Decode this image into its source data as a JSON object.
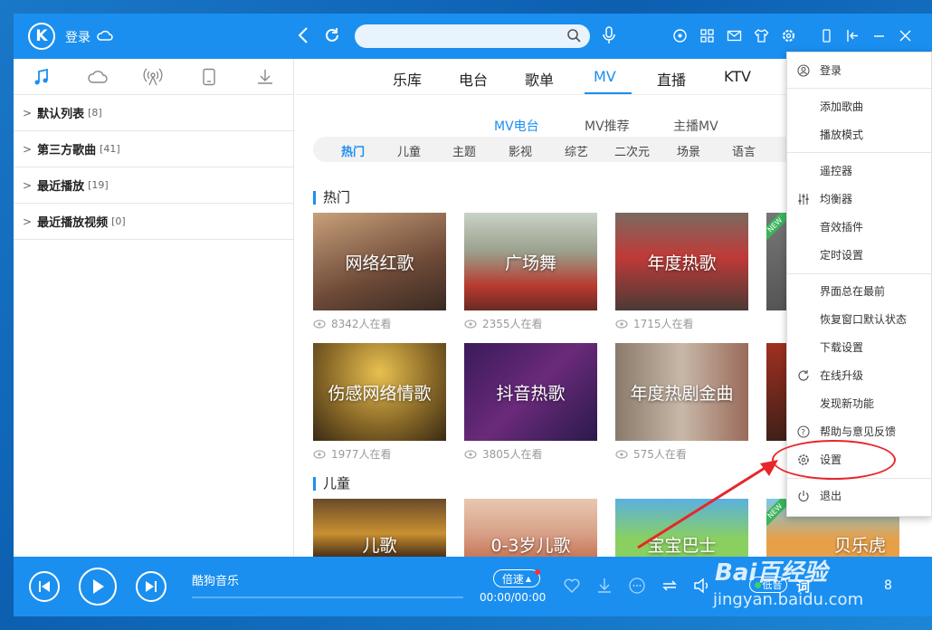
{
  "titlebar": {
    "login": "登录"
  },
  "sidebar": {
    "tabs": [
      "music-note-icon",
      "cloud-icon",
      "radio-icon",
      "device-icon",
      "download-icon"
    ],
    "playlists": [
      {
        "label": "默认列表",
        "count": "[8]"
      },
      {
        "label": "第三方歌曲",
        "count": "[41]"
      },
      {
        "label": "最近播放",
        "count": "[19]"
      },
      {
        "label": "最近播放视频",
        "count": "[0]"
      }
    ]
  },
  "main": {
    "tabs": [
      "乐库",
      "电台",
      "歌单",
      "MV",
      "直播",
      "KTV"
    ],
    "active_tab": "MV",
    "subtabs": [
      "MV电台",
      "MV推荐",
      "主播MV"
    ],
    "categories": [
      "热门",
      "儿童",
      "主题",
      "影视",
      "综艺",
      "二次元",
      "场景",
      "语言"
    ],
    "sections": [
      {
        "title": "热门"
      },
      {
        "title": "儿童"
      }
    ],
    "tiles": [
      {
        "label": "网络红歌",
        "viewers": "8342人在看"
      },
      {
        "label": "广场舞",
        "viewers": "2355人在看"
      },
      {
        "label": "年度热歌",
        "viewers": "1715人在看"
      },
      {
        "label": "伤感网络情歌",
        "viewers": "1977人在看"
      },
      {
        "label": "抖音热歌",
        "viewers": "3805人在看"
      },
      {
        "label": "年度热剧金曲",
        "viewers": "575人在看"
      },
      {
        "label": "儿歌"
      },
      {
        "label": "0-3岁儿歌"
      },
      {
        "label": "宝宝巴士"
      },
      {
        "label": "贝乐虎"
      }
    ],
    "new_badge": "NEW"
  },
  "player": {
    "song": "酷狗音乐",
    "speed": "倍速",
    "time": "00:00/00:00",
    "quality": "低音",
    "lyric": "词",
    "queue_count": "8"
  },
  "menu": {
    "items": [
      "登录",
      "添加歌曲",
      "播放模式",
      "遥控器",
      "均衡器",
      "音效插件",
      "定时设置",
      "界面总在最前",
      "恢复窗口默认状态",
      "下载设置",
      "在线升级",
      "发现新功能",
      "帮助与意见反馈",
      "设置",
      "退出"
    ]
  },
  "watermark": {
    "line1": "Bai百经验",
    "line2": "jingyan.baidu.com"
  },
  "colors": {
    "accent": "#1a8ff0",
    "annotation": "#e8262a"
  }
}
